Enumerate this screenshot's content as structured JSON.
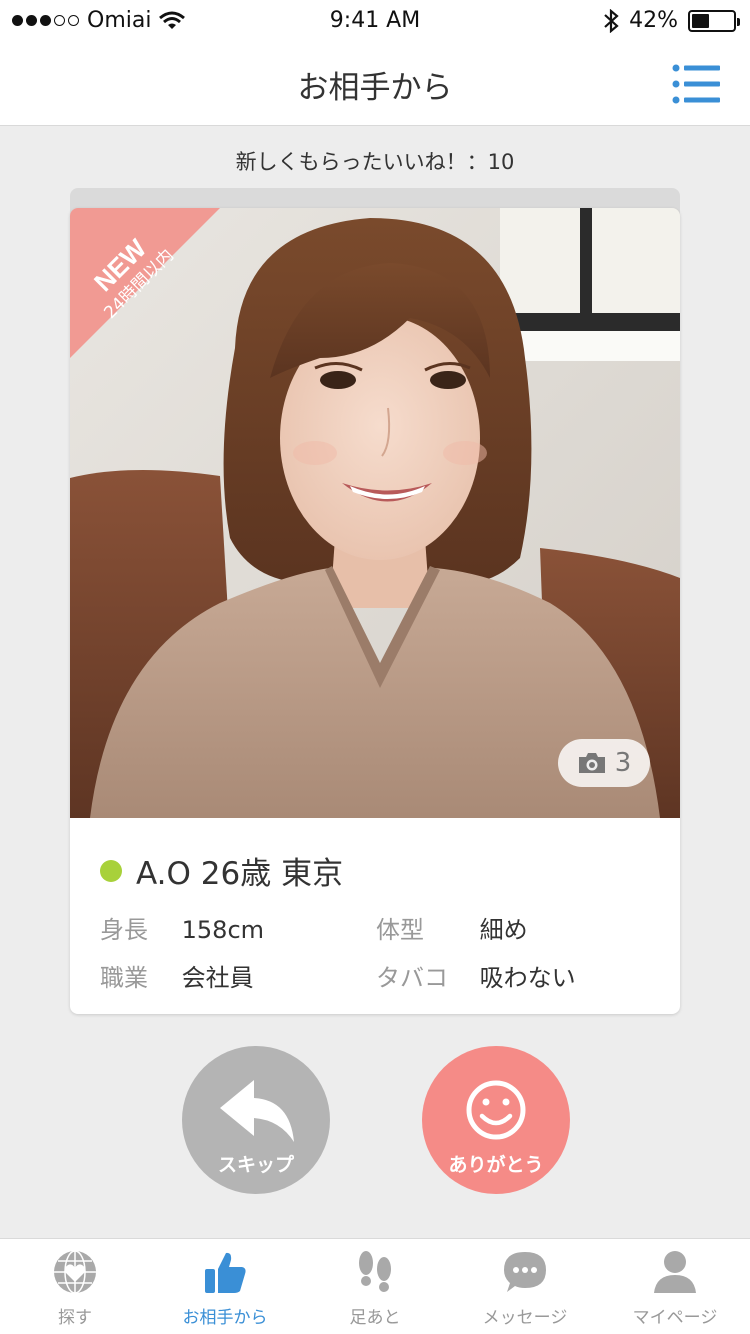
{
  "status_bar": {
    "carrier": "Omiai",
    "time": "9:41 AM",
    "battery": "42%",
    "battery_level": 0.42,
    "signal_bars_filled": 3,
    "signal_bars_total": 5
  },
  "header": {
    "title": "お相手から",
    "menu_icon": "list-icon"
  },
  "likes_summary": "新しくもらったいいね！：10",
  "profile": {
    "badge_new": "NEW",
    "badge_sub": "24時間以内",
    "photo_count": "3",
    "name_line": "A.O 26歳 東京",
    "online_color": "#a8d13a",
    "attributes": [
      {
        "label": "身長",
        "value": "158cm"
      },
      {
        "label": "体型",
        "value": "細め"
      },
      {
        "label": "職業",
        "value": "会社員"
      },
      {
        "label": "タバコ",
        "value": "吸わない"
      }
    ]
  },
  "actions": {
    "skip_label": "スキップ",
    "skip_color": "#b4b4b4",
    "thanks_label": "ありがとう",
    "thanks_color": "#f58b87"
  },
  "tabbar": {
    "active_color": "#3a8fd6",
    "items": [
      {
        "label": "探す",
        "icon": "globe-heart-icon"
      },
      {
        "label": "お相手から",
        "icon": "thumbs-up-icon",
        "active": true
      },
      {
        "label": "足あと",
        "icon": "footprints-icon"
      },
      {
        "label": "メッセージ",
        "icon": "chat-bubble-icon"
      },
      {
        "label": "マイページ",
        "icon": "person-icon"
      }
    ]
  }
}
